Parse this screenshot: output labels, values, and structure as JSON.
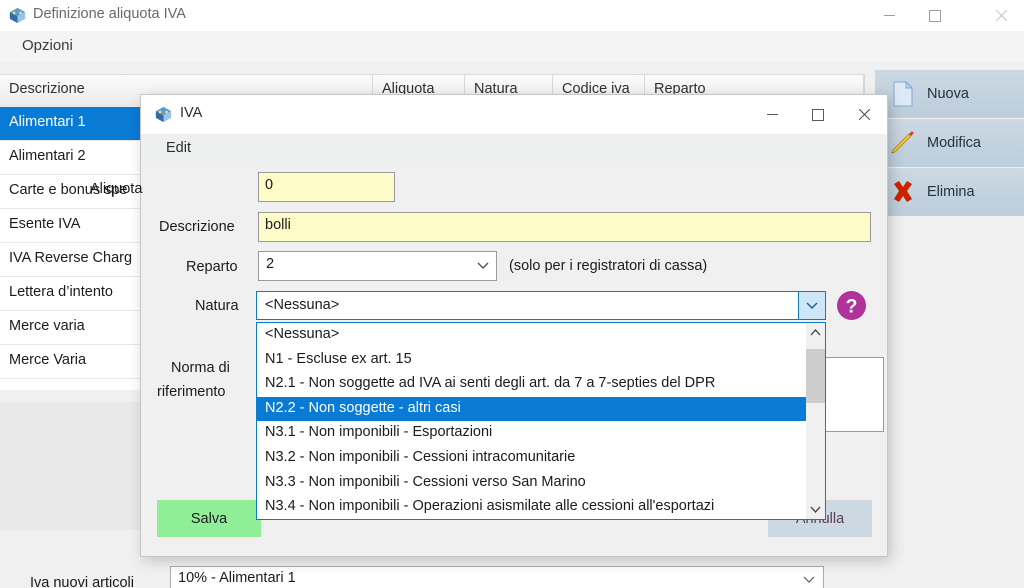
{
  "main_window": {
    "title": "Definizione aliquota IVA",
    "icon": "app-cube-icon",
    "window_controls": {
      "minimize": "minimize-icon",
      "maximize": "maximize-icon",
      "close": "close-icon"
    },
    "menu": [
      "Opzioni"
    ],
    "grid": {
      "columns": [
        "Descrizione",
        "Aliquota",
        "Natura",
        "Codice iva",
        "Reparto"
      ],
      "rows": [
        {
          "descrizione": "Alimentari 1",
          "aliquota": "",
          "natura": "",
          "codice_iva": "",
          "reparto": "",
          "selected": true
        },
        {
          "descrizione": "Alimentari 2",
          "aliquota": "",
          "natura": "",
          "codice_iva": "",
          "reparto": "",
          "selected": false
        },
        {
          "descrizione": "Carte e bonus spe",
          "aliquota": "",
          "natura": "",
          "codice_iva": "",
          "reparto": "",
          "selected": false
        },
        {
          "descrizione": "Esente IVA",
          "aliquota": "",
          "natura": "",
          "codice_iva": "",
          "reparto": "",
          "selected": false
        },
        {
          "descrizione": "IVA Reverse Charg",
          "aliquota": "",
          "natura": "",
          "codice_iva": "",
          "reparto": "",
          "selected": false
        },
        {
          "descrizione": "Lettera d’intento",
          "aliquota": "",
          "natura": "",
          "codice_iva": "",
          "reparto": "",
          "selected": false
        },
        {
          "descrizione": "Merce varia",
          "aliquota": "",
          "natura": "",
          "codice_iva": "",
          "reparto": "",
          "selected": false
        },
        {
          "descrizione": "Merce Varia",
          "aliquota": "",
          "natura": "",
          "codice_iva": "",
          "reparto": "",
          "selected": false
        }
      ]
    },
    "side_buttons": [
      {
        "label": "Nuova",
        "icon": "new-document-icon"
      },
      {
        "label": "Modifica",
        "icon": "pencil-edit-icon"
      },
      {
        "label": "Elimina",
        "icon": "red-x-delete-icon"
      }
    ],
    "footer": {
      "label": "Iva nuovi articoli",
      "combo_value": "10% - Alimentari 1",
      "combo_icon": "chevron-down-icon"
    }
  },
  "dialog": {
    "title": "IVA",
    "icon": "app-cube-icon",
    "window_controls": {
      "minimize": "minimize-icon",
      "maximize": "maximize-icon",
      "close": "close-icon"
    },
    "menu": [
      "Edit"
    ],
    "fields": {
      "aliquota": {
        "label": "Aliquota",
        "value": "0"
      },
      "descrizione": {
        "label": "Descrizione",
        "value": "bolli"
      },
      "reparto": {
        "label": "Reparto",
        "value": "2",
        "hint": "(solo per i registratori di cassa)",
        "icon": "chevron-down-icon"
      },
      "natura": {
        "label": "Natura",
        "value": "<Nessuna>",
        "icon": "chevron-down-icon",
        "expanded": true
      },
      "norma": {
        "label_line1": "Norma di",
        "label_line2": "riferimento",
        "value": ""
      }
    },
    "natura_options": [
      "<Nessuna>",
      "N1 - Escluse ex art. 15",
      "N2.1 - Non soggette ad IVA ai senti degli art. da 7 a 7-septies del DPR",
      "N2.2 - Non soggette - altri casi",
      "N3.1 - Non imponibili - Esportazioni",
      "N3.2 - Non imponibili - Cessioni intracomunitarie",
      "N3.3 - Non imponibili - Cessioni verso San Marino",
      "N3.4 - Non imponibili - Operazioni asismilate alle cessioni all'esportazi"
    ],
    "natura_selected_index": 3,
    "scrollbar": {
      "up_icon": "scroll-up-arrow-icon",
      "down_icon": "scroll-down-arrow-icon"
    },
    "help_icon": "help-question-icon",
    "buttons": {
      "save": "Salva",
      "cancel": "Annulla"
    }
  },
  "colors": {
    "accent_selection": "#0a7bd4",
    "field_yellow": "#fdfcc8",
    "save_green": "#90ee99",
    "cancel_blue_gray": "#ccd9e3",
    "help_purple": "#b0339c",
    "side_button": "#ccd9e3"
  }
}
